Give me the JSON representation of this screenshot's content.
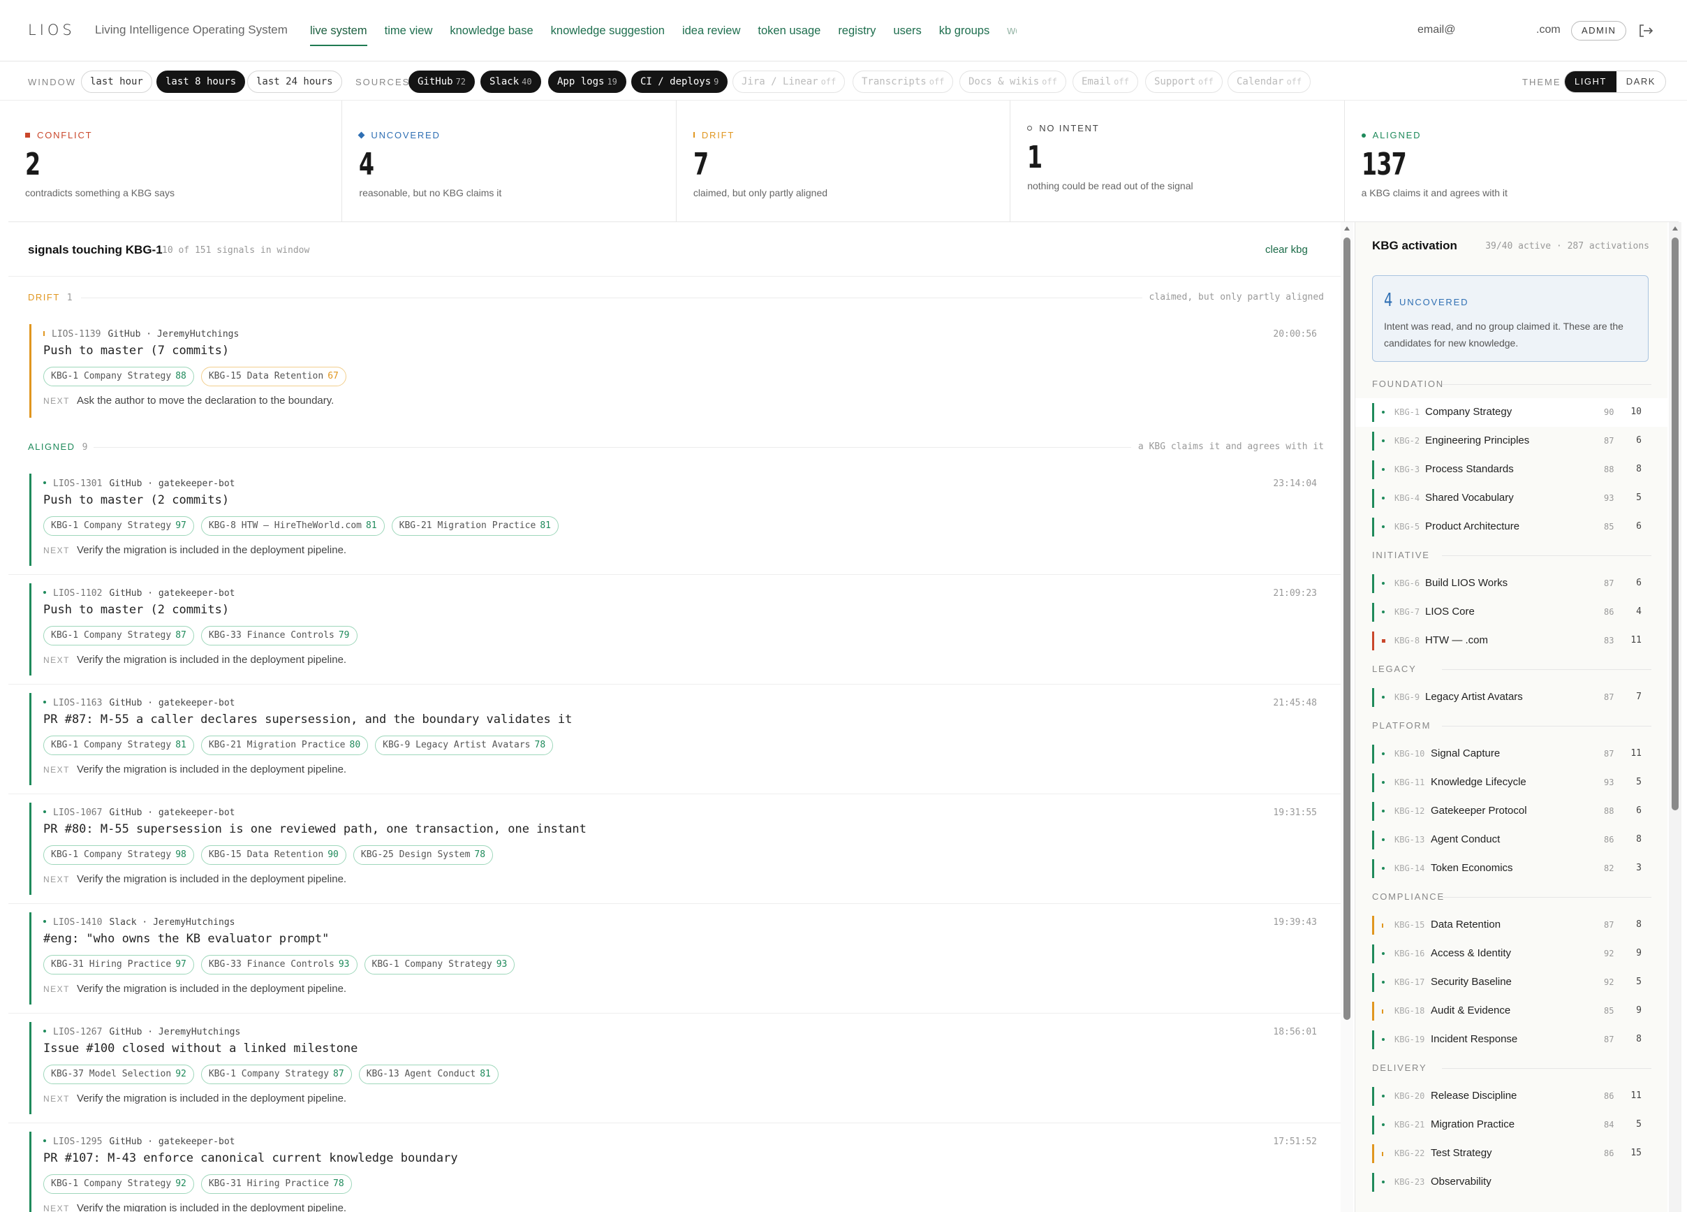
{
  "header": {
    "logo": "LIOS",
    "tagline": "Living Intelligence Operating System",
    "nav": [
      {
        "label": "live system",
        "active": true
      },
      {
        "label": "time view"
      },
      {
        "label": "knowledge base"
      },
      {
        "label": "knowledge suggestion"
      },
      {
        "label": "idea review"
      },
      {
        "label": "token usage"
      },
      {
        "label": "registry"
      },
      {
        "label": "users"
      },
      {
        "label": "kb groups"
      },
      {
        "label": "work"
      }
    ],
    "user_email": "email@",
    "user_domain": ".com",
    "role_badge": "ADMIN",
    "logout_icon": "logout-icon"
  },
  "filters": {
    "window_label": "WINDOW",
    "windows": [
      {
        "label": "last hour",
        "active": false
      },
      {
        "label": "last 8 hours",
        "active": true
      },
      {
        "label": "last 24 hours",
        "active": false
      }
    ],
    "sources_label": "SOURCES",
    "sources": [
      {
        "label": "GitHub",
        "count": "72",
        "state": "on"
      },
      {
        "label": "Slack",
        "count": "40",
        "state": "on"
      },
      {
        "label": "App logs",
        "count": "19",
        "state": "on"
      },
      {
        "label": "CI / deploys",
        "count": "9",
        "state": "on"
      },
      {
        "label": "Jira / Linear",
        "count": "off",
        "state": "off"
      },
      {
        "label": "Transcripts",
        "count": "off",
        "state": "off"
      },
      {
        "label": "Docs & wikis",
        "count": "off",
        "state": "off"
      },
      {
        "label": "Email",
        "count": "off",
        "state": "off"
      },
      {
        "label": "Support",
        "count": "off",
        "state": "off"
      },
      {
        "label": "Calendar",
        "count": "off",
        "state": "off"
      }
    ],
    "theme_label": "THEME",
    "theme_light": "LIGHT",
    "theme_dark": "DARK"
  },
  "summary": [
    {
      "label": "CONFLICT",
      "value": "2",
      "desc": "contradicts something a KBG says",
      "color": "#c9472b",
      "marker": "square"
    },
    {
      "label": "UNCOVERED",
      "value": "4",
      "desc": "reasonable, but no KBG claims it",
      "color": "#2f6fb3",
      "marker": "diamond"
    },
    {
      "label": "DRIFT",
      "value": "7",
      "desc": "claimed, but only partly aligned",
      "color": "#e0961f",
      "marker": "tick"
    },
    {
      "label": "NO INTENT",
      "value": "1",
      "desc": "nothing could be read out of the signal",
      "color": "#555555",
      "marker": "circle"
    },
    {
      "label": "ALIGNED",
      "value": "137",
      "desc": "a KBG claims it and agrees with it",
      "color": "#1f8a5b",
      "marker": "dot"
    }
  ],
  "main": {
    "title": "signals touching KBG-1",
    "subtitle": "10 of 151 signals in window",
    "clear": "clear kbg",
    "next_label": "NEXT",
    "sections": [
      {
        "name": "DRIFT",
        "count": "1",
        "desc": "claimed, but only partly aligned",
        "color": "#e0961f",
        "signals": [
          {
            "id": "LIOS-1139",
            "source": "GitHub · JeremyHutchings",
            "time": "20:00:56",
            "title": "Push to master (7 commits)",
            "tags": [
              {
                "label": "KBG-1 Company Strategy",
                "score": "88",
                "warn": false
              },
              {
                "label": "KBG-15 Data Retention",
                "score": "67",
                "warn": true
              }
            ],
            "next": "Ask the author to move the declaration to the boundary."
          }
        ]
      },
      {
        "name": "ALIGNED",
        "count": "9",
        "desc": "a KBG claims it and agrees with it",
        "color": "#1f8a5b",
        "signals": [
          {
            "id": "LIOS-1301",
            "source": "GitHub · gatekeeper-bot",
            "time": "23:14:04",
            "title": "Push to master (2 commits)",
            "tags": [
              {
                "label": "KBG-1 Company Strategy",
                "score": "97"
              },
              {
                "label": "KBG-8 HTW — HireTheWorld.com",
                "score": "81"
              },
              {
                "label": "KBG-21 Migration Practice",
                "score": "81"
              }
            ],
            "next": "Verify the migration is included in the deployment pipeline."
          },
          {
            "id": "LIOS-1102",
            "source": "GitHub · gatekeeper-bot",
            "time": "21:09:23",
            "title": "Push to master (2 commits)",
            "tags": [
              {
                "label": "KBG-1 Company Strategy",
                "score": "87"
              },
              {
                "label": "KBG-33 Finance Controls",
                "score": "79"
              }
            ],
            "next": "Verify the migration is included in the deployment pipeline."
          },
          {
            "id": "LIOS-1163",
            "source": "GitHub · gatekeeper-bot",
            "time": "21:45:48",
            "title": "PR #87: M-55 a caller declares supersession, and the boundary validates it",
            "tags": [
              {
                "label": "KBG-1 Company Strategy",
                "score": "81"
              },
              {
                "label": "KBG-21 Migration Practice",
                "score": "80"
              },
              {
                "label": "KBG-9 Legacy Artist Avatars",
                "score": "78"
              }
            ],
            "next": "Verify the migration is included in the deployment pipeline."
          },
          {
            "id": "LIOS-1067",
            "source": "GitHub · gatekeeper-bot",
            "time": "19:31:55",
            "title": "PR #80: M-55 supersession is one reviewed path, one transaction, one instant",
            "tags": [
              {
                "label": "KBG-1 Company Strategy",
                "score": "98"
              },
              {
                "label": "KBG-15 Data Retention",
                "score": "90"
              },
              {
                "label": "KBG-25 Design System",
                "score": "78"
              }
            ],
            "next": "Verify the migration is included in the deployment pipeline."
          },
          {
            "id": "LIOS-1410",
            "source": "Slack · JeremyHutchings",
            "time": "19:39:43",
            "title": "#eng: \"who owns the KB evaluator prompt\"",
            "tags": [
              {
                "label": "KBG-31 Hiring Practice",
                "score": "97"
              },
              {
                "label": "KBG-33 Finance Controls",
                "score": "93"
              },
              {
                "label": "KBG-1 Company Strategy",
                "score": "93"
              }
            ],
            "next": "Verify the migration is included in the deployment pipeline."
          },
          {
            "id": "LIOS-1267",
            "source": "GitHub · JeremyHutchings",
            "time": "18:56:01",
            "title": "Issue #100 closed without a linked milestone",
            "tags": [
              {
                "label": "KBG-37 Model Selection",
                "score": "92"
              },
              {
                "label": "KBG-1 Company Strategy",
                "score": "87"
              },
              {
                "label": "KBG-13 Agent Conduct",
                "score": "81"
              }
            ],
            "next": "Verify the migration is included in the deployment pipeline."
          },
          {
            "id": "LIOS-1295",
            "source": "GitHub · gatekeeper-bot",
            "time": "17:51:52",
            "title": "PR #107: M-43 enforce canonical current knowledge boundary",
            "tags": [
              {
                "label": "KBG-1 Company Strategy",
                "score": "92"
              },
              {
                "label": "KBG-31 Hiring Practice",
                "score": "78"
              }
            ],
            "next": "Verify the migration is included in the deployment pipeline."
          }
        ]
      }
    ]
  },
  "panel": {
    "title": "KBG activation",
    "stats": "39/40 active · 287 activations",
    "uncovered_count": "4",
    "uncovered_label": "UNCOVERED",
    "uncovered_desc": "Intent was read, and no group claimed it. These are the candidates for new knowledge.",
    "groups": [
      {
        "label": "FOUNDATION",
        "items": [
          {
            "id": "KBG-1",
            "name": "Company Strategy",
            "score": "90",
            "count": "10",
            "status": "aligned",
            "selected": true
          },
          {
            "id": "KBG-2",
            "name": "Engineering Principles",
            "score": "87",
            "count": "6",
            "status": "aligned"
          },
          {
            "id": "KBG-3",
            "name": "Process Standards",
            "score": "88",
            "count": "8",
            "status": "aligned"
          },
          {
            "id": "KBG-4",
            "name": "Shared Vocabulary",
            "score": "93",
            "count": "5",
            "status": "aligned"
          },
          {
            "id": "KBG-5",
            "name": "Product Architecture",
            "score": "85",
            "count": "6",
            "status": "aligned"
          }
        ]
      },
      {
        "label": "INITIATIVE",
        "items": [
          {
            "id": "KBG-6",
            "name": "Build LIOS Works",
            "score": "87",
            "count": "6",
            "status": "aligned"
          },
          {
            "id": "KBG-7",
            "name": "LIOS Core",
            "score": "86",
            "count": "4",
            "status": "aligned"
          },
          {
            "id": "KBG-8",
            "name": "HTW —                    .com",
            "score": "83",
            "count": "11",
            "status": "conflict"
          }
        ]
      },
      {
        "label": "LEGACY",
        "items": [
          {
            "id": "KBG-9",
            "name": "Legacy Artist Avatars",
            "score": "87",
            "count": "7",
            "status": "aligned"
          }
        ]
      },
      {
        "label": "PLATFORM",
        "items": [
          {
            "id": "KBG-10",
            "name": "Signal Capture",
            "score": "87",
            "count": "11",
            "status": "aligned"
          },
          {
            "id": "KBG-11",
            "name": "Knowledge Lifecycle",
            "score": "93",
            "count": "5",
            "status": "aligned"
          },
          {
            "id": "KBG-12",
            "name": "Gatekeeper Protocol",
            "score": "88",
            "count": "6",
            "status": "aligned"
          },
          {
            "id": "KBG-13",
            "name": "Agent Conduct",
            "score": "86",
            "count": "8",
            "status": "aligned"
          },
          {
            "id": "KBG-14",
            "name": "Token Economics",
            "score": "82",
            "count": "3",
            "status": "aligned"
          }
        ]
      },
      {
        "label": "COMPLIANCE",
        "items": [
          {
            "id": "KBG-15",
            "name": "Data Retention",
            "score": "87",
            "count": "8",
            "status": "drift"
          },
          {
            "id": "KBG-16",
            "name": "Access & Identity",
            "score": "92",
            "count": "9",
            "status": "aligned"
          },
          {
            "id": "KBG-17",
            "name": "Security Baseline",
            "score": "92",
            "count": "5",
            "status": "aligned"
          },
          {
            "id": "KBG-18",
            "name": "Audit & Evidence",
            "score": "85",
            "count": "9",
            "status": "drift"
          },
          {
            "id": "KBG-19",
            "name": "Incident Response",
            "score": "87",
            "count": "8",
            "status": "aligned"
          }
        ]
      },
      {
        "label": "DELIVERY",
        "items": [
          {
            "id": "KBG-20",
            "name": "Release Discipline",
            "score": "86",
            "count": "11",
            "status": "aligned"
          },
          {
            "id": "KBG-21",
            "name": "Migration Practice",
            "score": "84",
            "count": "5",
            "status": "aligned"
          },
          {
            "id": "KBG-22",
            "name": "Test Strategy",
            "score": "86",
            "count": "15",
            "status": "drift"
          },
          {
            "id": "KBG-23",
            "name": "Observability",
            "score": "",
            "count": "",
            "status": "aligned"
          }
        ]
      }
    ]
  },
  "colors": {
    "aligned": "#1f8a5b",
    "drift": "#e0961f",
    "conflict": "#c9472b",
    "uncovered": "#2f6fb3"
  }
}
